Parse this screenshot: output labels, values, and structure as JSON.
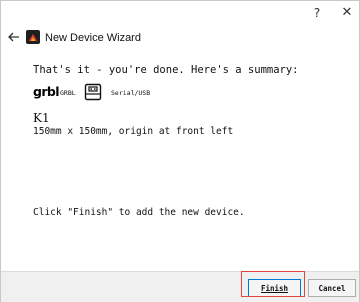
{
  "window": {
    "help_label": "?",
    "close_label": "✕"
  },
  "header": {
    "title": "New Device Wizard",
    "back_icon": "arrow-left-icon",
    "app_icon": "lightburn-wizard-icon"
  },
  "summary": {
    "intro": "That's it - you're done.  Here's a summary:",
    "firmware_logo": "grbl",
    "firmware_label": "GRBL",
    "connection_icon": "usb-serial-icon",
    "connection_label": "Serial/USB",
    "device_name": "K1",
    "device_description": "150mm x 150mm, origin at front left"
  },
  "hint": {
    "text": "Click \"Finish\" to add the new device."
  },
  "footer": {
    "finish_label": "Finish",
    "cancel_label": "Cancel",
    "highlight_color": "#e0463a",
    "focus_color": "#0078d7"
  }
}
